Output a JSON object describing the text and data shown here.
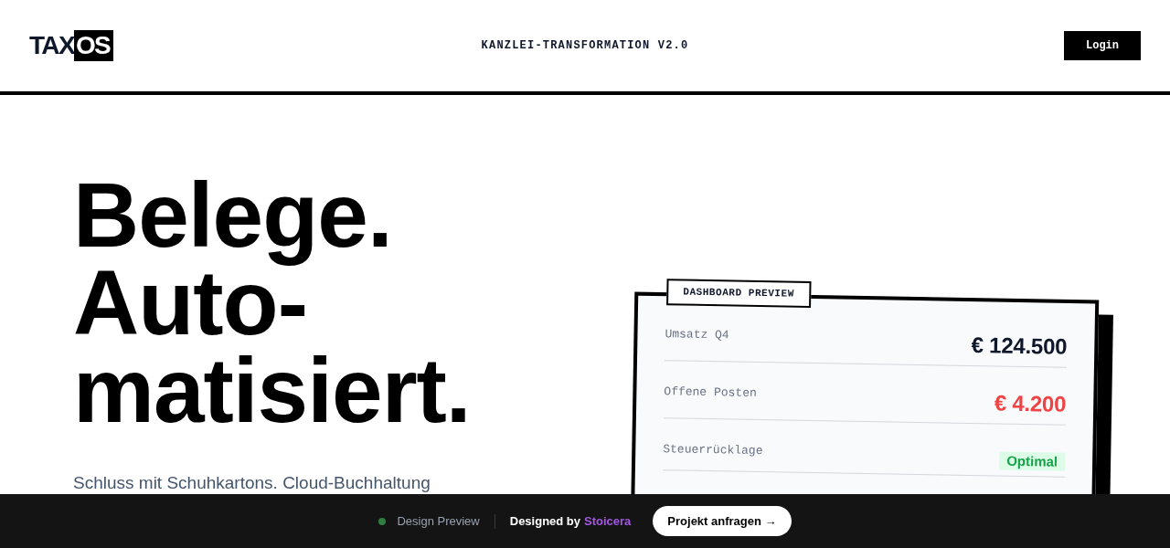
{
  "header": {
    "logo": {
      "text": "TAX",
      "highlight": "OS"
    },
    "tagline": "KANZLEI-TRANSFORMATION V2.0",
    "login_button": "Login"
  },
  "hero": {
    "headline_lines": [
      "Belege.",
      "Auto-",
      "matisiert."
    ],
    "subtitle": "Schluss mit Schuhkartons. Cloud-Buchhaltung"
  },
  "dashboard_preview": {
    "label": "DASHBOARD PREVIEW",
    "rows": [
      {
        "label": "Umsatz Q4",
        "value": "€ 124.500",
        "kind": "amount",
        "color": "#0f172a"
      },
      {
        "label": "Offene Posten",
        "value": "€ 4.200",
        "kind": "amount",
        "color": "#ef4444"
      },
      {
        "label": "Steuerrücklage",
        "value": "Optimal",
        "kind": "badge",
        "color": "#16a34a"
      }
    ]
  },
  "preview_bar": {
    "status": "Design Preview",
    "credit": {
      "text": "Designed by",
      "link": "Stoicera"
    },
    "cta_button": "Projekt anfragen →"
  }
}
